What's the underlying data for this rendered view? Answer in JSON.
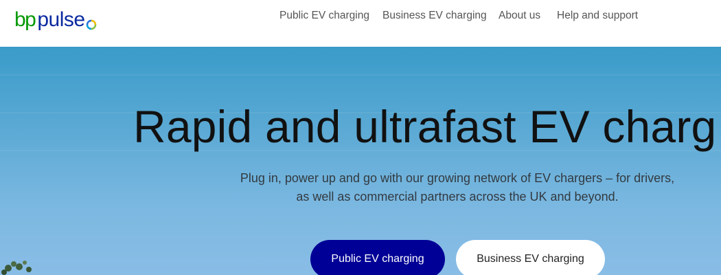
{
  "brand": {
    "logo_bp": "bp",
    "logo_pulse": "pulse",
    "logo_mark_icon": "helios-ring-icon",
    "colors": {
      "bp_green": "#009900",
      "pulse_blue": "#0a2aa0",
      "primary_button": "#000096"
    }
  },
  "nav": {
    "items": [
      {
        "label": "Public EV charging"
      },
      {
        "label": "Business EV charging"
      },
      {
        "label": "About us"
      },
      {
        "label": "Help and support"
      }
    ]
  },
  "hero": {
    "title": "Rapid and ultrafast EV charg",
    "subtitle": "Plug in, power up and go with our growing network of EV chargers – for drivers, as well as commercial partners across the UK and beyond.",
    "primary_button": "Public EV charging",
    "secondary_button": "Business EV charging"
  }
}
